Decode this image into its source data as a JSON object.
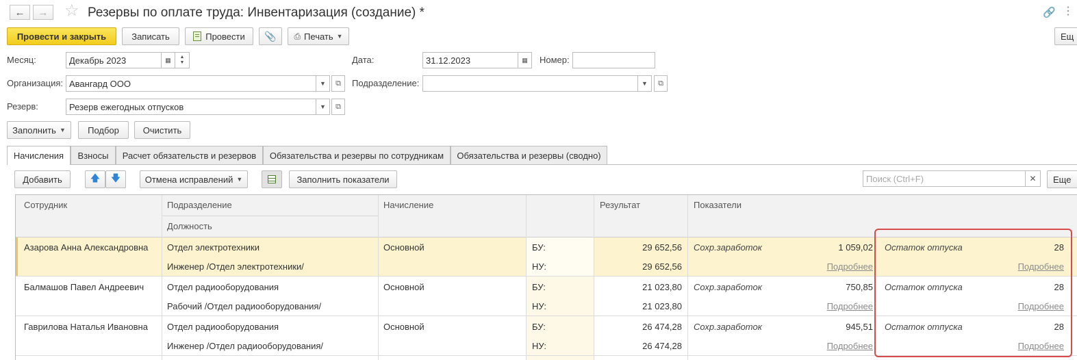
{
  "window": {
    "title": "Резервы по оплате труда: Инвентаризация (создание) *",
    "back_icon": "arrow-left-icon",
    "forward_icon": "arrow-right-icon",
    "favorite_icon": "star-icon",
    "link_icon": "link-icon",
    "more_icon": "more-icon"
  },
  "toolbar": {
    "post_close": "Провести и закрыть",
    "save": "Записать",
    "post": "Провести",
    "print": "Печать",
    "more_right": "Ещ"
  },
  "form": {
    "month_label": "Месяц:",
    "month_value": "Декабрь 2023",
    "date_label": "Дата:",
    "date_value": "31.12.2023",
    "number_label": "Номер:",
    "number_value": "",
    "org_label": "Организация:",
    "org_value": "Авангард ООО",
    "dept_label": "Подразделение:",
    "dept_value": "",
    "reserve_label": "Резерв:",
    "reserve_value": "Резерв ежегодных отпусков"
  },
  "actions": {
    "fill": "Заполнить",
    "select": "Подбор",
    "clear": "Очистить"
  },
  "tabs": [
    {
      "label": "Начисления",
      "active": true
    },
    {
      "label": "Взносы"
    },
    {
      "label": "Расчет обязательств и резервов"
    },
    {
      "label": "Обязательства и резервы по сотрудникам"
    },
    {
      "label": "Обязательства и резервы (сводно)"
    }
  ],
  "tab_toolbar": {
    "add": "Добавить",
    "cancel_corrections": "Отмена исправлений",
    "fill_indicators": "Заполнить показатели",
    "search_placeholder": "Поиск (Ctrl+F)",
    "more": "Еще"
  },
  "table": {
    "headers": {
      "employee": "Сотрудник",
      "department": "Подразделение",
      "position": "Должность",
      "accrual": "Начисление",
      "result": "Результат",
      "indicators": "Показатели"
    },
    "rows": [
      {
        "employee": "Азарова Анна Александровна",
        "department": "Отдел электротехники",
        "position": "Инженер /Отдел электротехники/",
        "accrual": "Основной",
        "bu_label": "БУ:",
        "nu_label": "НУ:",
        "result_bu": "29 652,56",
        "result_nu": "29 652,56",
        "ind1_name": "Сохр.заработок",
        "ind1_value": "1 059,02",
        "ind1_more": "Подробнее",
        "ind2_name": "Остаток отпуска",
        "ind2_value": "28",
        "ind2_more": "Подробнее",
        "selected": true
      },
      {
        "employee": "Балмашов Павел Андреевич",
        "department": "Отдел радиооборудования",
        "position": "Рабочий /Отдел радиооборудования/",
        "accrual": "Основной",
        "bu_label": "БУ:",
        "nu_label": "НУ:",
        "result_bu": "21 023,80",
        "result_nu": "21 023,80",
        "ind1_name": "Сохр.заработок",
        "ind1_value": "750,85",
        "ind1_more": "Подробнее",
        "ind2_name": "Остаток отпуска",
        "ind2_value": "28",
        "ind2_more": "Подробнее"
      },
      {
        "employee": "Гаврилова Наталья Ивановна",
        "department": "Отдел радиооборудования",
        "position": "Инженер /Отдел радиооборудования/",
        "accrual": "Основной",
        "bu_label": "БУ:",
        "nu_label": "НУ:",
        "result_bu": "26 474,28",
        "result_nu": "26 474,28",
        "ind1_name": "Сохр.заработок",
        "ind1_value": "945,51",
        "ind1_more": "Подробнее",
        "ind2_name": "Остаток отпуска",
        "ind2_value": "28",
        "ind2_more": "Подробнее"
      }
    ]
  },
  "colors": {
    "primary_button": "#f2cd1c",
    "selected_row": "#fdf4cf",
    "highlight_box": "#d94a4a"
  }
}
